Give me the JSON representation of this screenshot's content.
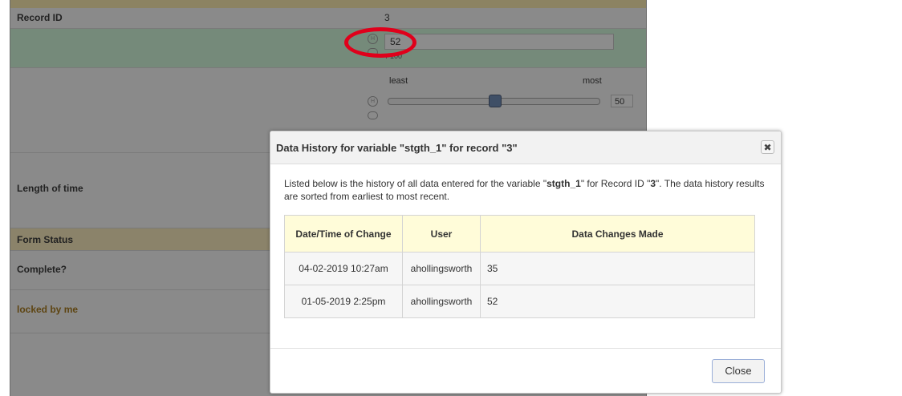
{
  "form": {
    "record_label": "Record ID",
    "record_value": "3",
    "field_value": "52",
    "field_note": "/ 100",
    "slider_least": "least",
    "slider_most": "most",
    "slider_value": "50",
    "slider_level_fraction": 0.5,
    "length_label": "Length of time",
    "status_label": "Form Status",
    "complete_label": "Complete?",
    "locked_label": "locked by me"
  },
  "dialog": {
    "title": "Data History for variable \"stgth_1\" for record \"3\"",
    "desc_prefix": "Listed below is the history of all data entered for the variable \"",
    "desc_var": "stgth_1",
    "desc_mid": "\" for Record ID \"",
    "desc_rec": "3",
    "desc_suffix": "\". The data history results are sorted from earliest to most recent.",
    "columns": [
      "Date/Time of Change",
      "User",
      "Data Changes Made"
    ],
    "rows": [
      {
        "date": "04-02-2019 10:27am",
        "user": "ahollingsworth",
        "value": "35"
      },
      {
        "date": "01-05-2019 2:25pm",
        "user": "ahollingsworth",
        "value": "52"
      }
    ],
    "close_label": "Close",
    "close_icon": "close-x-icon"
  },
  "icons": {
    "history": "history-icon",
    "comment": "comment-icon"
  },
  "colors": {
    "annotation": "#e0001b",
    "table_header": "#fffcd9"
  }
}
